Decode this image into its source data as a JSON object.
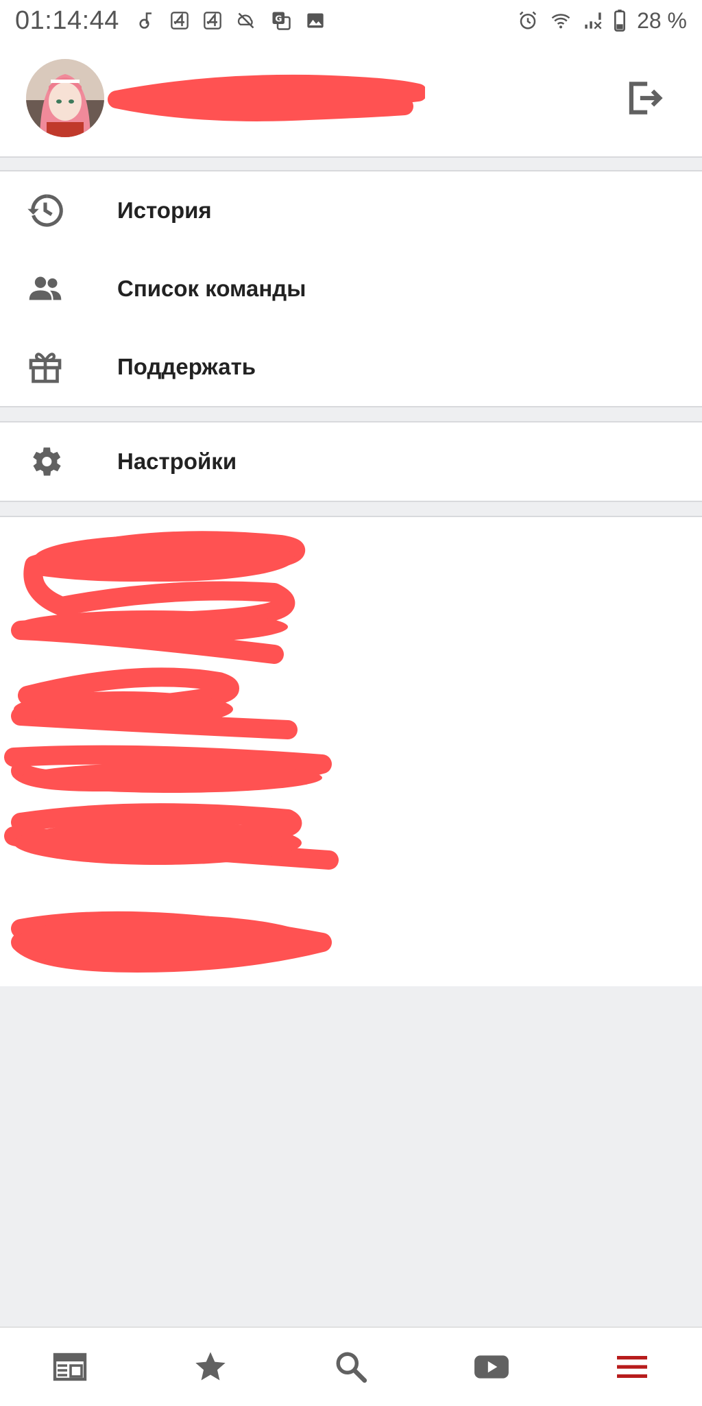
{
  "status_bar": {
    "time": "01:14:44",
    "battery_percent": "28 %",
    "icons": [
      "music-note-icon",
      "notification-4-icon",
      "notification-4-icon",
      "sync-off-icon",
      "translate-icon",
      "image-icon",
      "alarm-icon",
      "wifi-icon",
      "signal-icon",
      "battery-icon"
    ]
  },
  "profile": {
    "avatar_icon": "user-avatar",
    "logout_icon": "logout-icon"
  },
  "menu_main": [
    {
      "label": "История",
      "icon": "history-icon"
    },
    {
      "label": "Список команды",
      "icon": "team-icon"
    },
    {
      "label": "Поддержать",
      "icon": "gift-icon"
    }
  ],
  "menu_settings": {
    "label": "Настройки",
    "icon": "gear-icon"
  },
  "bottom_nav": [
    {
      "icon": "news-icon",
      "active": false
    },
    {
      "icon": "star-icon",
      "active": false
    },
    {
      "icon": "search-icon",
      "active": false
    },
    {
      "icon": "youtube-icon",
      "active": false
    },
    {
      "icon": "menu-icon",
      "active": true
    }
  ],
  "colors": {
    "accent": "#b71c1c",
    "icon_gray": "#616161",
    "redaction": "#ff5252",
    "background": "#eeeff1"
  }
}
